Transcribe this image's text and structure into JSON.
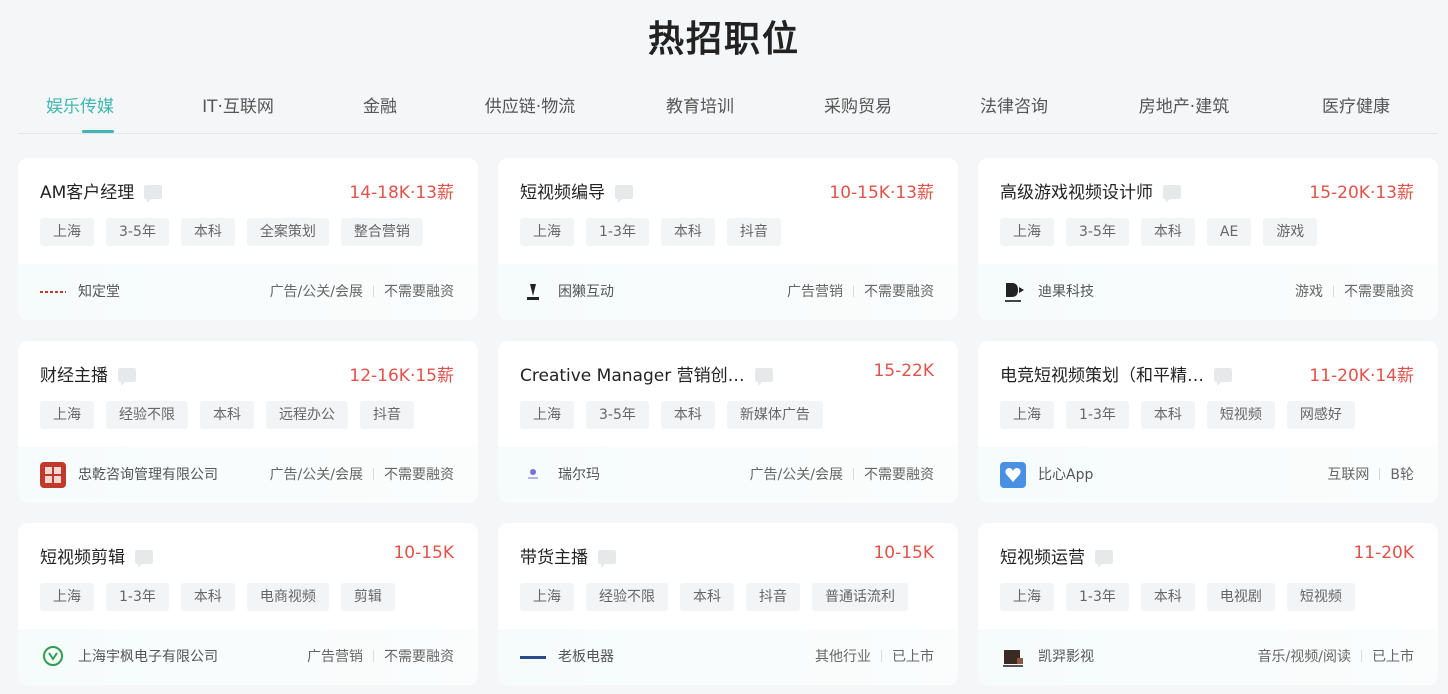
{
  "page_title": "热招职位",
  "tabs": [
    "娱乐传媒",
    "IT·互联网",
    "金融",
    "供应链·物流",
    "教育培训",
    "采购贸易",
    "法律咨询",
    "房地产·建筑",
    "医疗健康"
  ],
  "colors": {
    "accent": "#3fb6b2",
    "salary": "#e0524a"
  },
  "jobs": [
    {
      "name": "AM客户经理",
      "salary": "14-18K·13薪",
      "tags": [
        "上海",
        "3-5年",
        "本科",
        "全案策划",
        "整合营销"
      ],
      "company": "知定堂",
      "industry": "广告/公关/会展",
      "funding": "不需要融资"
    },
    {
      "name": "短视频编导",
      "salary": "10-15K·13薪",
      "tags": [
        "上海",
        "1-3年",
        "本科",
        "抖音"
      ],
      "company": "困獭互动",
      "industry": "广告营销",
      "funding": "不需要融资"
    },
    {
      "name": "高级游戏视频设计师",
      "salary": "15-20K·13薪",
      "tags": [
        "上海",
        "3-5年",
        "本科",
        "AE",
        "游戏"
      ],
      "company": "迪果科技",
      "industry": "游戏",
      "funding": "不需要融资"
    },
    {
      "name": "财经主播",
      "salary": "12-16K·15薪",
      "tags": [
        "上海",
        "经验不限",
        "本科",
        "远程办公",
        "抖音"
      ],
      "company": "忠乾咨询管理有限公司",
      "industry": "广告/公关/会展",
      "funding": "不需要融资"
    },
    {
      "name": "Creative Manager 营销创…",
      "salary": "15-22K",
      "tags": [
        "上海",
        "3-5年",
        "本科",
        "新媒体广告"
      ],
      "company": "瑞尔玛",
      "industry": "广告/公关/会展",
      "funding": "不需要融资"
    },
    {
      "name": "电竞短视频策划（和平精…",
      "salary": "11-20K·14薪",
      "tags": [
        "上海",
        "1-3年",
        "本科",
        "短视频",
        "网感好"
      ],
      "company": "比心App",
      "industry": "互联网",
      "funding": "B轮"
    },
    {
      "name": "短视频剪辑",
      "salary": "10-15K",
      "tags": [
        "上海",
        "1-3年",
        "本科",
        "电商视频",
        "剪辑"
      ],
      "company": "上海宇枫电子有限公司",
      "industry": "广告营销",
      "funding": "不需要融资"
    },
    {
      "name": "带货主播",
      "salary": "10-15K",
      "tags": [
        "上海",
        "经验不限",
        "本科",
        "抖音",
        "普通话流利"
      ],
      "company": "老板电器",
      "industry": "其他行业",
      "funding": "已上市"
    },
    {
      "name": "短视频运营",
      "salary": "11-20K",
      "tags": [
        "上海",
        "1-3年",
        "本科",
        "电视剧",
        "短视频"
      ],
      "company": "凯羿影视",
      "industry": "音乐/视频/阅读",
      "funding": "已上市"
    }
  ]
}
